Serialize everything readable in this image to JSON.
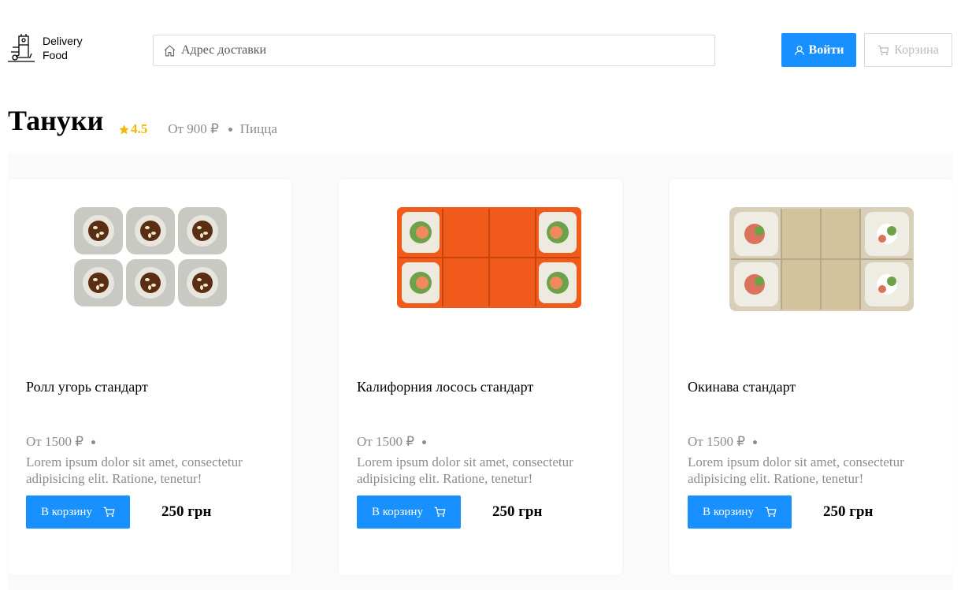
{
  "header": {
    "logo_line1": "Delivery",
    "logo_line2": "Food",
    "search_placeholder": "Адрес доставки",
    "login_label": "Войти",
    "cart_label": "Корзина"
  },
  "restaurant": {
    "name": "Тануки",
    "rating": "4.5",
    "price": "От 900 ₽",
    "category": "Пицца"
  },
  "colors": {
    "accent": "#1890ff",
    "rating": "#f5b800",
    "muted": "#8c8c8c"
  },
  "products": [
    {
      "title": "Ролл угорь стандарт",
      "price_from": "От 1500 ₽",
      "description": "Lorem ipsum dolor sit amet, consectetur adipisicing elit. Ratione, tenetur!",
      "button_label": "В корзину",
      "cost": "250 грн",
      "image": "eel-roll-photo"
    },
    {
      "title": "Калифорния лосось стандарт",
      "price_from": "От 1500 ₽",
      "description": "Lorem ipsum dolor sit amet, consectetur adipisicing elit. Ratione, tenetur!",
      "button_label": "В корзину",
      "cost": "250 грн",
      "image": "california-salmon-roll-photo"
    },
    {
      "title": "Окинава стандарт",
      "price_from": "От 1500 ₽",
      "description": "Lorem ipsum dolor sit amet, consectetur adipisicing elit. Ratione, tenetur!",
      "button_label": "В корзину",
      "cost": "250 грн",
      "image": "okinawa-roll-photo"
    }
  ]
}
